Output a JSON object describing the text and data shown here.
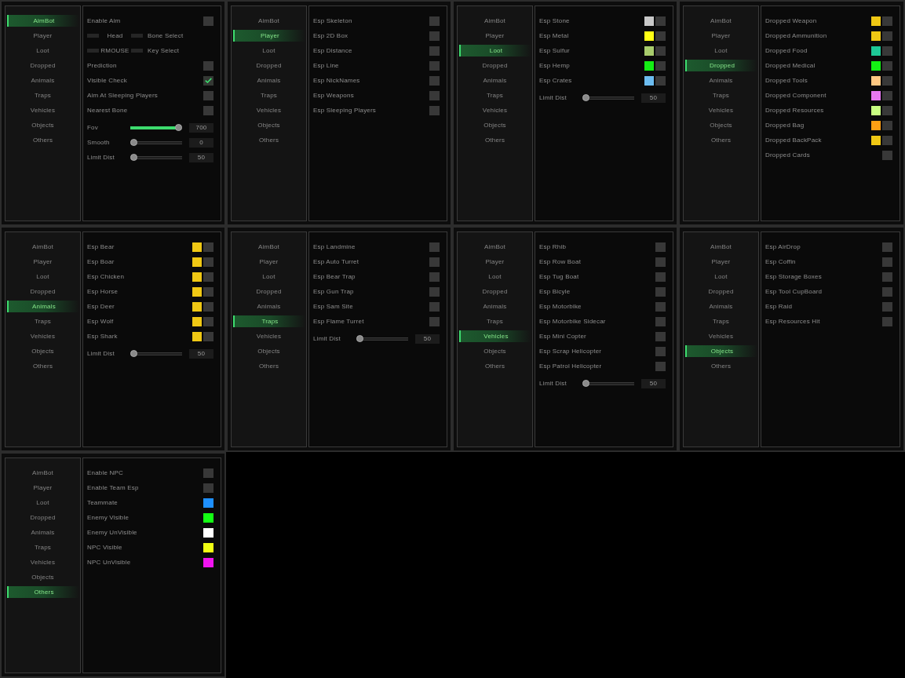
{
  "panels": [
    {
      "nav": [
        {
          "label": "AimBot",
          "selected": true
        },
        {
          "label": "Player",
          "selected": false
        },
        {
          "label": "Loot",
          "selected": false
        },
        {
          "label": "Dropped",
          "selected": false
        },
        {
          "label": "Animals",
          "selected": false
        },
        {
          "label": "Traps",
          "selected": false
        },
        {
          "label": "Vehicles",
          "selected": false
        },
        {
          "label": "Objects",
          "selected": false
        },
        {
          "label": "Others",
          "selected": false
        }
      ],
      "rows": [
        {
          "kind": "checkbox",
          "label": "Enable Aim",
          "checked": false
        },
        {
          "kind": "combo",
          "option": "Head",
          "label": "Bone Select"
        },
        {
          "kind": "combo",
          "option": "RMOUSE",
          "label": "Key Select"
        },
        {
          "kind": "checkbox",
          "label": "Prediction",
          "checked": false
        },
        {
          "kind": "checkbox",
          "label": "Visible Check",
          "checked": true
        },
        {
          "kind": "checkbox",
          "label": "Aim At Sleeping Players",
          "checked": false
        },
        {
          "kind": "checkbox",
          "label": "Nearest Bone",
          "checked": false
        },
        {
          "kind": "slider",
          "label": "Fov",
          "level": 1,
          "value": "700"
        },
        {
          "kind": "slider",
          "label": "Smooth",
          "level": 0,
          "value": "0"
        },
        {
          "kind": "slider",
          "label": "Limit Dist",
          "level": 0,
          "value": "50"
        }
      ]
    },
    {
      "nav": [
        {
          "label": "AimBot",
          "selected": false
        },
        {
          "label": "Player",
          "selected": true
        },
        {
          "label": "Loot",
          "selected": false
        },
        {
          "label": "Dropped",
          "selected": false
        },
        {
          "label": "Animals",
          "selected": false
        },
        {
          "label": "Traps",
          "selected": false
        },
        {
          "label": "Vehicles",
          "selected": false
        },
        {
          "label": "Objects",
          "selected": false
        },
        {
          "label": "Others",
          "selected": false
        }
      ],
      "rows": [
        {
          "kind": "checkbox",
          "label": "Esp Skeleton",
          "checked": false
        },
        {
          "kind": "checkbox",
          "label": "Esp 2D Box",
          "checked": false
        },
        {
          "kind": "checkbox",
          "label": "Esp Distance",
          "checked": false
        },
        {
          "kind": "checkbox",
          "label": "Esp Line",
          "checked": false
        },
        {
          "kind": "checkbox",
          "label": "Esp NickNames",
          "checked": false
        },
        {
          "kind": "checkbox",
          "label": "Esp Weapons",
          "checked": false
        },
        {
          "kind": "checkbox",
          "label": "Esp Sleeping Players",
          "checked": false
        }
      ]
    },
    {
      "nav": [
        {
          "label": "AimBot",
          "selected": false
        },
        {
          "label": "Player",
          "selected": false
        },
        {
          "label": "Loot",
          "selected": true
        },
        {
          "label": "Dropped",
          "selected": false
        },
        {
          "label": "Animals",
          "selected": false
        },
        {
          "label": "Traps",
          "selected": false
        },
        {
          "label": "Vehicles",
          "selected": false
        },
        {
          "label": "Objects",
          "selected": false
        },
        {
          "label": "Others",
          "selected": false
        }
      ],
      "rows": [
        {
          "kind": "color_checkbox",
          "label": "Esp Stone",
          "color": "#c8c8c8",
          "checked": false
        },
        {
          "kind": "color_checkbox",
          "label": "Esp Metal",
          "color": "#ffff14",
          "checked": false
        },
        {
          "kind": "color_checkbox",
          "label": "Esp Sulfur",
          "color": "#a8cc6c",
          "checked": false
        },
        {
          "kind": "color_checkbox",
          "label": "Esp Hemp",
          "color": "#14ee14",
          "checked": false
        },
        {
          "kind": "color_checkbox",
          "label": "Esp Crates",
          "color": "#6cbcf0",
          "checked": false
        },
        {
          "kind": "slider",
          "label": "Limit Dist",
          "level": 0,
          "value": "50"
        }
      ]
    },
    {
      "nav": [
        {
          "label": "AimBot",
          "selected": false
        },
        {
          "label": "Player",
          "selected": false
        },
        {
          "label": "Loot",
          "selected": false
        },
        {
          "label": "Dropped",
          "selected": true
        },
        {
          "label": "Animals",
          "selected": false
        },
        {
          "label": "Traps",
          "selected": false
        },
        {
          "label": "Vehicles",
          "selected": false
        },
        {
          "label": "Objects",
          "selected": false
        },
        {
          "label": "Others",
          "selected": false
        }
      ],
      "rows": [
        {
          "kind": "color_checkbox",
          "label": "Dropped Weapon",
          "color": "#f0c814",
          "checked": false
        },
        {
          "kind": "color_checkbox",
          "label": "Dropped Ammunition",
          "color": "#f0c814",
          "checked": false
        },
        {
          "kind": "color_checkbox",
          "label": "Dropped Food",
          "color": "#1ec896",
          "checked": false
        },
        {
          "kind": "color_checkbox",
          "label": "Dropped Medical",
          "color": "#14f014",
          "checked": false
        },
        {
          "kind": "color_checkbox",
          "label": "Dropped Tools",
          "color": "#ffc882",
          "checked": false
        },
        {
          "kind": "color_checkbox",
          "label": "Dropped Component",
          "color": "#e678f0",
          "checked": false
        },
        {
          "kind": "color_checkbox",
          "label": "Dropped Resources",
          "color": "#c8ff82",
          "checked": false
        },
        {
          "kind": "color_checkbox",
          "label": "Dropped Bag",
          "color": "#ffa014",
          "checked": false
        },
        {
          "kind": "color_checkbox",
          "label": "Dropped BackPack",
          "color": "#f0c814",
          "checked": false
        },
        {
          "kind": "checkbox",
          "label": "Dropped Cards",
          "checked": false
        }
      ]
    },
    {
      "nav": [
        {
          "label": "AimBot",
          "selected": false
        },
        {
          "label": "Player",
          "selected": false
        },
        {
          "label": "Loot",
          "selected": false
        },
        {
          "label": "Dropped",
          "selected": false
        },
        {
          "label": "Animals",
          "selected": true
        },
        {
          "label": "Traps",
          "selected": false
        },
        {
          "label": "Vehicles",
          "selected": false
        },
        {
          "label": "Objects",
          "selected": false
        },
        {
          "label": "Others",
          "selected": false
        }
      ],
      "rows": [
        {
          "kind": "color_checkbox",
          "label": "Esp Bear",
          "color": "#f0c814",
          "checked": false
        },
        {
          "kind": "color_checkbox",
          "label": "Esp Boar",
          "color": "#f0c814",
          "checked": false
        },
        {
          "kind": "color_checkbox",
          "label": "Esp Chicken",
          "color": "#f0c814",
          "checked": false
        },
        {
          "kind": "color_checkbox",
          "label": "Esp Horse",
          "color": "#f0c814",
          "checked": false
        },
        {
          "kind": "color_checkbox",
          "label": "Esp Deer",
          "color": "#f0c814",
          "checked": false
        },
        {
          "kind": "color_checkbox",
          "label": "Esp Wolf",
          "color": "#f0c814",
          "checked": false
        },
        {
          "kind": "color_checkbox",
          "label": "Esp Shark",
          "color": "#f0c814",
          "checked": false
        },
        {
          "kind": "slider",
          "label": "Limit Dist",
          "level": 0,
          "value": "50"
        }
      ]
    },
    {
      "nav": [
        {
          "label": "AimBot",
          "selected": false
        },
        {
          "label": "Player",
          "selected": false
        },
        {
          "label": "Loot",
          "selected": false
        },
        {
          "label": "Dropped",
          "selected": false
        },
        {
          "label": "Animals",
          "selected": false
        },
        {
          "label": "Traps",
          "selected": true
        },
        {
          "label": "Vehicles",
          "selected": false
        },
        {
          "label": "Objects",
          "selected": false
        },
        {
          "label": "Others",
          "selected": false
        }
      ],
      "rows": [
        {
          "kind": "checkbox",
          "label": "Esp Landmine",
          "checked": false
        },
        {
          "kind": "checkbox",
          "label": "Esp Auto Turret",
          "checked": false
        },
        {
          "kind": "checkbox",
          "label": "Esp Bear Trap",
          "checked": false
        },
        {
          "kind": "checkbox",
          "label": "Esp Gun Trap",
          "checked": false
        },
        {
          "kind": "checkbox",
          "label": "Esp Sam Site",
          "checked": false
        },
        {
          "kind": "checkbox",
          "label": "Esp Flame Turret",
          "checked": false
        },
        {
          "kind": "slider",
          "label": "Limit Dist",
          "level": 0,
          "value": "50"
        }
      ]
    },
    {
      "nav": [
        {
          "label": "AimBot",
          "selected": false
        },
        {
          "label": "Player",
          "selected": false
        },
        {
          "label": "Loot",
          "selected": false
        },
        {
          "label": "Dropped",
          "selected": false
        },
        {
          "label": "Animals",
          "selected": false
        },
        {
          "label": "Traps",
          "selected": false
        },
        {
          "label": "Vehicles",
          "selected": true
        },
        {
          "label": "Objects",
          "selected": false
        },
        {
          "label": "Others",
          "selected": false
        }
      ],
      "rows": [
        {
          "kind": "checkbox",
          "label": "Esp Rhib",
          "checked": false
        },
        {
          "kind": "checkbox",
          "label": "Esp Row Boat",
          "checked": false
        },
        {
          "kind": "checkbox",
          "label": "Esp Tug Boat",
          "checked": false
        },
        {
          "kind": "checkbox",
          "label": "Esp Bicyle",
          "checked": false
        },
        {
          "kind": "checkbox",
          "label": "Esp Motorbike",
          "checked": false
        },
        {
          "kind": "checkbox",
          "label": "Esp Motorbike Sidecar",
          "checked": false
        },
        {
          "kind": "checkbox",
          "label": "Esp Mini Copter",
          "checked": false
        },
        {
          "kind": "checkbox",
          "label": "Esp Scrap Helicopter",
          "checked": false
        },
        {
          "kind": "checkbox",
          "label": "Esp Patrol Helicopter",
          "checked": false
        },
        {
          "kind": "slider",
          "label": "Limit Dist",
          "level": 0,
          "value": "50"
        }
      ]
    },
    {
      "nav": [
        {
          "label": "AimBot",
          "selected": false
        },
        {
          "label": "Player",
          "selected": false
        },
        {
          "label": "Loot",
          "selected": false
        },
        {
          "label": "Dropped",
          "selected": false
        },
        {
          "label": "Animals",
          "selected": false
        },
        {
          "label": "Traps",
          "selected": false
        },
        {
          "label": "Vehicles",
          "selected": false
        },
        {
          "label": "Objects",
          "selected": true
        },
        {
          "label": "Others",
          "selected": false
        }
      ],
      "rows": [
        {
          "kind": "checkbox",
          "label": "Esp AirDrop",
          "checked": false
        },
        {
          "kind": "checkbox",
          "label": "Esp Coffin",
          "checked": false
        },
        {
          "kind": "checkbox",
          "label": "Esp Storage Boxes",
          "checked": false
        },
        {
          "kind": "checkbox",
          "label": "Esp Tool CupBoard",
          "checked": false
        },
        {
          "kind": "checkbox",
          "label": "Esp Raid",
          "checked": false
        },
        {
          "kind": "checkbox",
          "label": "Esp Resources Hit",
          "checked": false
        }
      ]
    },
    {
      "nav": [
        {
          "label": "AimBot",
          "selected": false
        },
        {
          "label": "Player",
          "selected": false
        },
        {
          "label": "Loot",
          "selected": false
        },
        {
          "label": "Dropped",
          "selected": false
        },
        {
          "label": "Animals",
          "selected": false
        },
        {
          "label": "Traps",
          "selected": false
        },
        {
          "label": "Vehicles",
          "selected": false
        },
        {
          "label": "Objects",
          "selected": false
        },
        {
          "label": "Others",
          "selected": true
        }
      ],
      "rows": [
        {
          "kind": "checkbox",
          "label": "Enable NPC",
          "checked": false
        },
        {
          "kind": "checkbox",
          "label": "Enable Team Esp",
          "checked": false
        },
        {
          "kind": "color",
          "label": "Teammate",
          "color": "#1e90ff"
        },
        {
          "kind": "color",
          "label": "Enemy Visible",
          "color": "#14ff14"
        },
        {
          "kind": "color",
          "label": "Enemy UnVisible",
          "color": "#ffffff"
        },
        {
          "kind": "color",
          "label": "NPC Visible",
          "color": "#f0ff14"
        },
        {
          "kind": "color",
          "label": "NPC UnVisible",
          "color": "#f014f0"
        }
      ]
    }
  ]
}
